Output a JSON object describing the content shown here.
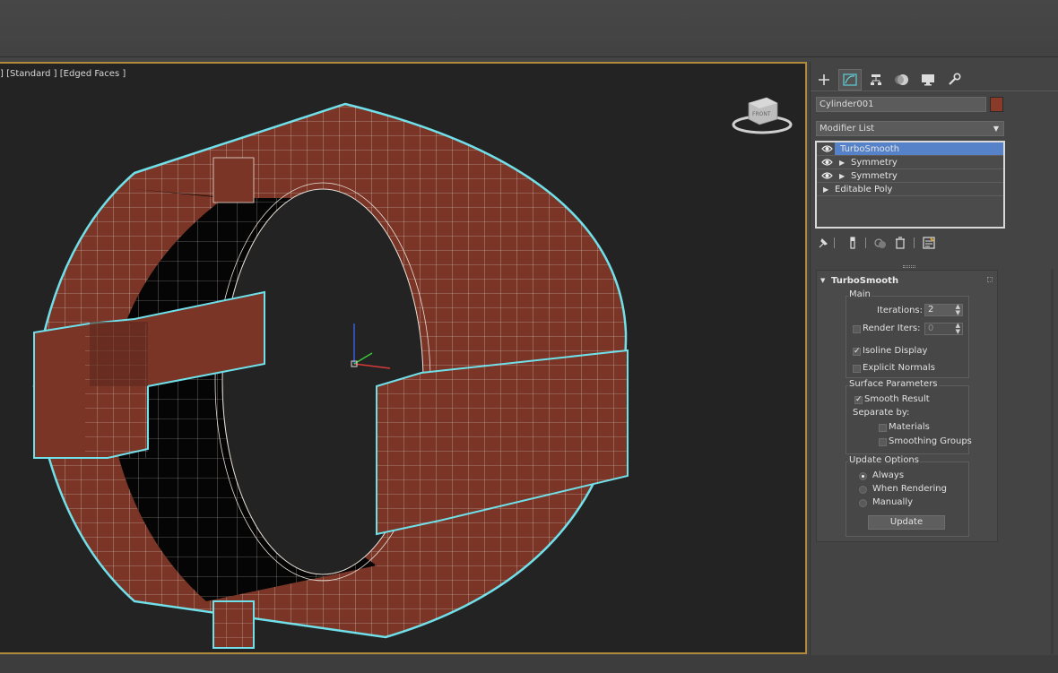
{
  "viewport": {
    "label": "[Standard ] [Edged Faces ]",
    "label_prefix": "]",
    "viewcube_text": "FRONT",
    "colors": {
      "mesh": "#7a3526",
      "wire": "#e8e0d8",
      "outline": "#6fe0ea",
      "background": "#232323",
      "border": "#b08a3a"
    }
  },
  "command_panel": {
    "tabs": [
      "create-icon",
      "modify-icon",
      "hierarchy-icon",
      "motion-icon",
      "display-icon",
      "utilities-icon"
    ],
    "object_name": "Cylinder001",
    "object_color": "#8a3a28",
    "modifier_list": "Modifier List",
    "stack": [
      {
        "label": "TurboSmooth",
        "selected": true,
        "has_eye": true,
        "has_tri": false
      },
      {
        "label": "Symmetry",
        "selected": false,
        "has_eye": true,
        "has_tri": true
      },
      {
        "label": "Symmetry",
        "selected": false,
        "has_eye": true,
        "has_tri": true
      },
      {
        "label": "Editable Poly",
        "selected": false,
        "has_eye": false,
        "has_tri": true
      }
    ],
    "rollout": {
      "title": "TurboSmooth",
      "main": {
        "title": "Main",
        "iterations_label": "Iterations:",
        "iterations_value": "2",
        "render_iters_label": "Render Iters:",
        "render_iters_value": "0",
        "isoline_label": "Isoline Display",
        "explicit_normals_label": "Explicit Normals"
      },
      "surface": {
        "title": "Surface Parameters",
        "smooth_result_label": "Smooth Result",
        "separate_by_label": "Separate by:",
        "materials_label": "Materials",
        "smoothing_groups_label": "Smoothing Groups"
      },
      "update": {
        "title": "Update Options",
        "always_label": "Always",
        "when_rendering_label": "When Rendering",
        "manually_label": "Manually",
        "update_button": "Update"
      }
    }
  }
}
